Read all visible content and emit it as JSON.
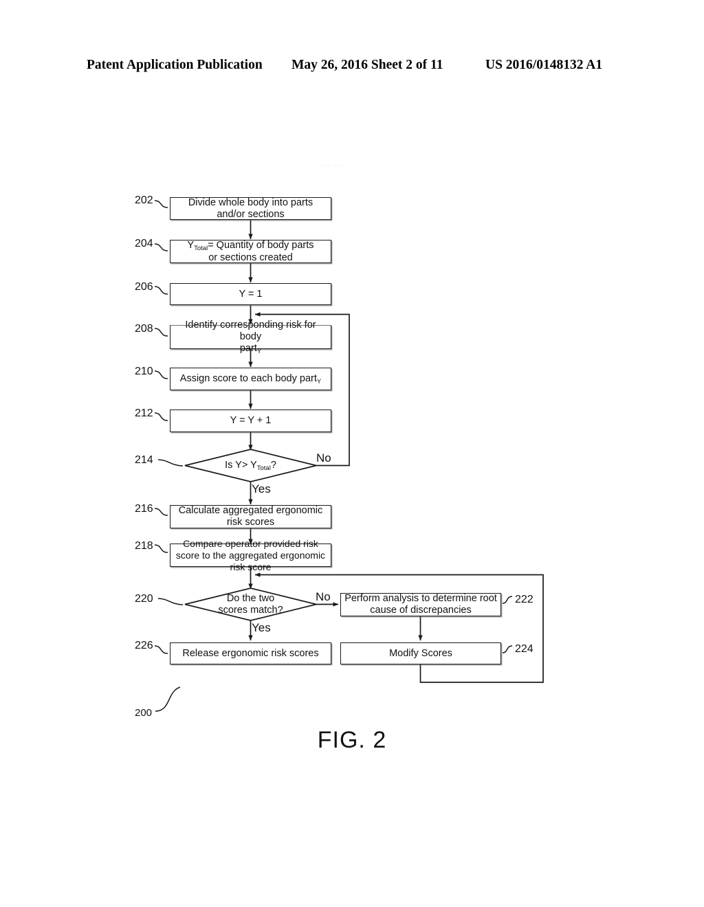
{
  "header": {
    "publication": "Patent Application Publication",
    "date_sheet": "May 26, 2016  Sheet 2 of 11",
    "patent_number": "US 2016/0148132 A1"
  },
  "figure": {
    "caption": "FIG. 2",
    "diagram_ref": "200",
    "nodes": [
      {
        "ref": "202",
        "type": "process",
        "text_lines": [
          "Divide whole body into parts and/or",
          "sections"
        ]
      },
      {
        "ref": "204",
        "type": "process",
        "text_html": "Y<sub>Total</sub>= Quantity of body parts<br>or sections created"
      },
      {
        "ref": "206",
        "type": "process",
        "text_lines": [
          "Y = 1"
        ]
      },
      {
        "ref": "208",
        "type": "process",
        "text_html": "Identify corresponding risk for body<br>part<sub>Y</sub>"
      },
      {
        "ref": "210",
        "type": "process",
        "text_html": "Assign score to each body part<sub>Y</sub>"
      },
      {
        "ref": "212",
        "type": "process",
        "text_lines": [
          "Y = Y + 1"
        ]
      },
      {
        "ref": "214",
        "type": "decision",
        "text_html": "Is Y&gt; Y<sub>Total</sub>?"
      },
      {
        "ref": "216",
        "type": "process",
        "text_lines": [
          "Calculate aggregated ergonomic risk",
          "scores"
        ]
      },
      {
        "ref": "218",
        "type": "process",
        "text_lines": [
          "Compare operator provided risk score",
          "to the aggregated ergonomic risk score"
        ]
      },
      {
        "ref": "220",
        "type": "decision",
        "text_lines": [
          "Do the two",
          "scores match?"
        ]
      },
      {
        "ref": "222",
        "type": "process",
        "text_lines": [
          "Perform analysis to determine root",
          "cause of discrepancies"
        ]
      },
      {
        "ref": "224",
        "type": "process",
        "text_lines": [
          "Modify Scores"
        ]
      },
      {
        "ref": "226",
        "type": "process",
        "text_lines": [
          "Release ergonomic risk scores"
        ]
      }
    ],
    "edge_labels": {
      "d214_no": "No",
      "d214_yes": "Yes",
      "d220_no": "No",
      "d220_yes": "Yes"
    },
    "box_text": {
      "n202": "Divide whole body into parts and/or sections",
      "n206": "Y = 1",
      "n212": "Y = Y + 1",
      "n216": "Calculate aggregated ergonomic risk scores",
      "n218": "Compare operator provided risk score to the aggregated ergonomic risk score",
      "n222": "Perform analysis to determine root cause of discrepancies",
      "n224": "Modify Scores",
      "n226": "Release ergonomic risk scores"
    },
    "refs": {
      "r202": "202",
      "r204": "204",
      "r206": "206",
      "r208": "208",
      "r210": "210",
      "r212": "212",
      "r214": "214",
      "r216": "216",
      "r218": "218",
      "r220": "220",
      "r222": "222",
      "r224": "224",
      "r226": "226",
      "r200": "200"
    },
    "colors": {
      "line": "#1a1a1a",
      "background": "#ffffff",
      "shadow": "#8a8a8a"
    }
  }
}
